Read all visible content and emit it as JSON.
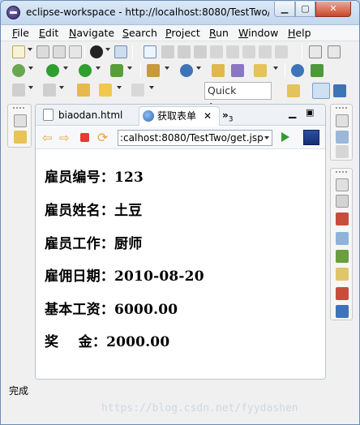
{
  "window": {
    "title": "eclipse-workspace - http://localhost:8080/TestTwo/..."
  },
  "menu": [
    {
      "key": "F",
      "rest": "ile"
    },
    {
      "key": "E",
      "rest": "dit"
    },
    {
      "key": "N",
      "rest": "avigate"
    },
    {
      "key": "S",
      "rest": "earch"
    },
    {
      "key": "P",
      "rest": "roject"
    },
    {
      "key": "R",
      "rest": "un"
    },
    {
      "key": "W",
      "rest": "indow"
    },
    {
      "key": "H",
      "rest": "elp"
    }
  ],
  "toolbar": {
    "quick_access": "Quick Access"
  },
  "tabs": {
    "tab1": "biaodan.html",
    "tab2": "获取表单",
    "more": "»",
    "more_count": "3"
  },
  "nav": {
    "url": ":calhost:8080/TestTwo/get.jsp"
  },
  "content": {
    "lines": [
      "雇员编号：123",
      "雇员姓名：土豆",
      "雇员工作：厨师",
      "雇佣日期：2010-08-20",
      "基本工资：6000.00",
      "奖    金：2000.00"
    ]
  },
  "status": {
    "text": "完成"
  },
  "watermark": {
    "text": "https://blog.csdn.net/fyydashen"
  },
  "colors": {
    "accent": "#3d74b8",
    "run_green": "#2f9e2f",
    "stop_red": "#e53935"
  }
}
